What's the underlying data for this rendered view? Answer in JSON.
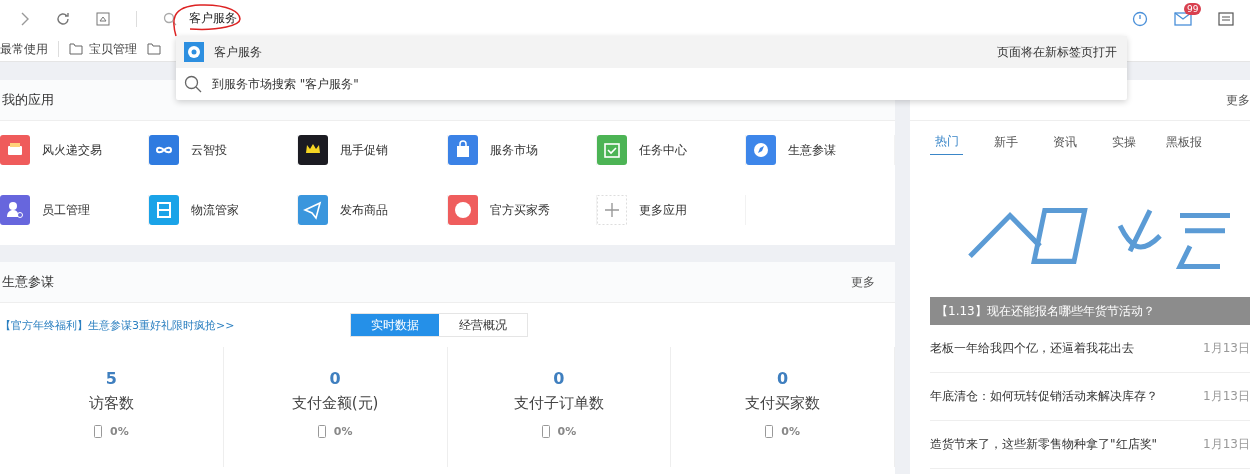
{
  "toolbar": {
    "address": "客户服务",
    "mail_badge": "99"
  },
  "bookmarks": [
    {
      "label": "最常使用",
      "kind": "text"
    },
    {
      "label": "宝贝管理",
      "kind": "folder"
    },
    {
      "kind": "folder"
    }
  ],
  "suggestions": [
    {
      "kind": "app",
      "label": "客户服务",
      "hint": "页面将在新标签页打开",
      "selected": true
    },
    {
      "kind": "search",
      "label": "到服务市场搜索 \"客户服务\"",
      "selected": false
    }
  ],
  "apps": {
    "title": "我的应用",
    "items": [
      {
        "label": "风火递交易",
        "color": "#ef5b5b"
      },
      {
        "label": "云智投",
        "color": "#2f7be0"
      },
      {
        "label": "甩手促销",
        "color": "#1b1b22"
      },
      {
        "label": "服务市场",
        "color": "#3b82e6"
      },
      {
        "label": "任务中心",
        "color": "#4cb455"
      },
      {
        "label": "生意参谋",
        "color": "#3d86ea"
      },
      {
        "label": "员工管理",
        "color": "#6766dd"
      },
      {
        "label": "物流管家",
        "color": "#1aa3e8"
      },
      {
        "label": "发布商品",
        "color": "#3a96dd"
      },
      {
        "label": "官方买家秀",
        "color": "#ef5d5d"
      },
      {
        "label": "更多应用",
        "kind": "add"
      }
    ]
  },
  "advisor": {
    "title": "生意参谋",
    "more": "更多",
    "promo": "【官方年终福利】生意参谋3重好礼限时疯抢>>",
    "tabs": [
      {
        "label": "实时数据",
        "selected": true
      },
      {
        "label": "经营概况",
        "selected": false
      }
    ],
    "stats": [
      {
        "value": "5",
        "label": "访客数",
        "change": "0%"
      },
      {
        "value": "0",
        "label": "支付金额(元)",
        "change": "0%"
      },
      {
        "value": "0",
        "label": "支付子订单数",
        "change": "0%"
      },
      {
        "value": "0",
        "label": "支付买家数",
        "change": "0%"
      }
    ]
  },
  "news": {
    "more": "更多",
    "tabs": [
      {
        "label": "热门",
        "selected": true
      },
      {
        "label": "新手",
        "selected": false
      },
      {
        "label": "资讯",
        "selected": false
      },
      {
        "label": "实操",
        "selected": false
      },
      {
        "label": "黑板报",
        "selected": false
      }
    ],
    "banner": {
      "kind": "picture",
      "caption": "【1.13】现在还能报名哪些年货节活动？"
    },
    "items": [
      {
        "title": "老板一年给我四个亿，还逼着我花出去",
        "date": "1月13日"
      },
      {
        "title": "年底清仓：如何玩转促销活动来解决库存？",
        "date": "1月13日"
      },
      {
        "title": "造货节来了，这些新零售物种拿了\"红店奖\"",
        "date": "1月13日"
      }
    ]
  }
}
